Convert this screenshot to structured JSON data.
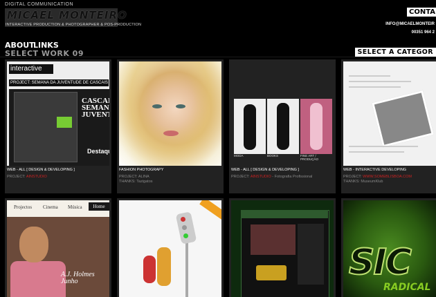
{
  "header": {
    "tagline": "DIGITAL COMMUNICATION",
    "logo": "MICAEL MONTEIRO",
    "subtitle": "INTERACTIVE PRODUCTION & PHOTOGRAPHER & POS-PRODUCTION",
    "contact_label": "CONTA",
    "email": "INFO@MICAELMONTEIR",
    "phone": "00351 964 2"
  },
  "nav": {
    "about": "ABOUT",
    "links": "LINKS",
    "select_work": "SELECT WORK 09",
    "select_category": "SELECT A CATEGOR"
  },
  "thumbs": {
    "t1": {
      "bar": "interactive",
      "project": "PROJECT: SEMANA DA JUVENTUDE DE CASCAIS 2",
      "cascais": "CASCAIS SEMANA JUVENTUDE",
      "destaq": "Destaqu"
    },
    "t3": {
      "cap1": "MODA",
      "cap2": "BOOKS",
      "cap3": "FINE ART / PRODUÇÃO"
    },
    "t5": {
      "nav1": "Projectos",
      "nav2": "Cinema",
      "nav3": "Música",
      "home": "Home",
      "holmes": "A.J. Holmes Junho"
    },
    "t8": {
      "sic": "SIC",
      "radical": "RADICAL"
    }
  },
  "works": [
    {
      "category": "WEB - ALL [ DESIGN & DEVELOPING ]",
      "project_label": "PROJECT:",
      "project_value": "AINSTUDIO",
      "thanks": ""
    },
    {
      "category": "FASHION PHOTOGRAPY",
      "project_label": "PROJECT:",
      "project_value": "ALINA",
      "thanks": "THANKS: Tazigatos"
    },
    {
      "category": "WEB - ALL [ DESIGN & DEVELOPING ]",
      "project_label": "PROJECT:",
      "project_value": "AINSTUDIO",
      "project_extra": " - Fotografia Profissional",
      "thanks": ""
    },
    {
      "category": "WEB - INTERACTIVE DEVELOPING",
      "project_label": "PROJECT:",
      "project_value": "WWW.SOMEBLISBOA.COM",
      "thanks": "THANKS: MuseumKlub"
    }
  ],
  "colors": {
    "background": "#000000",
    "card": "#222222",
    "accent_red": "#cc2222",
    "button_bg": "#ffffff"
  }
}
